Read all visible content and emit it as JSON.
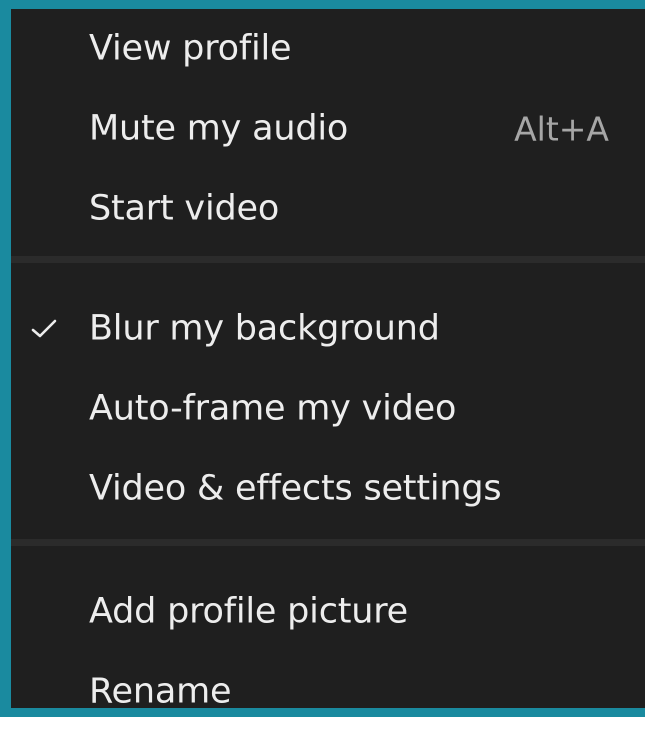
{
  "menu": {
    "items": [
      {
        "label": "View profile"
      },
      {
        "label": "Mute my audio",
        "shortcut": "Alt+A"
      },
      {
        "label": "Start video"
      },
      {
        "label": "Blur my background",
        "checked": true
      },
      {
        "label": "Auto-frame my video"
      },
      {
        "label": "Video & effects settings"
      },
      {
        "label": "Add profile picture"
      },
      {
        "label": "Rename"
      }
    ]
  },
  "icons": {
    "checkmark": "check-icon"
  },
  "colors": {
    "menu_background": "#1f1f1f",
    "frame_accent": "#1a8a9f",
    "text": "#ededed",
    "shortcut_text": "#a6a6a6",
    "separator": "#2b2b2b"
  }
}
